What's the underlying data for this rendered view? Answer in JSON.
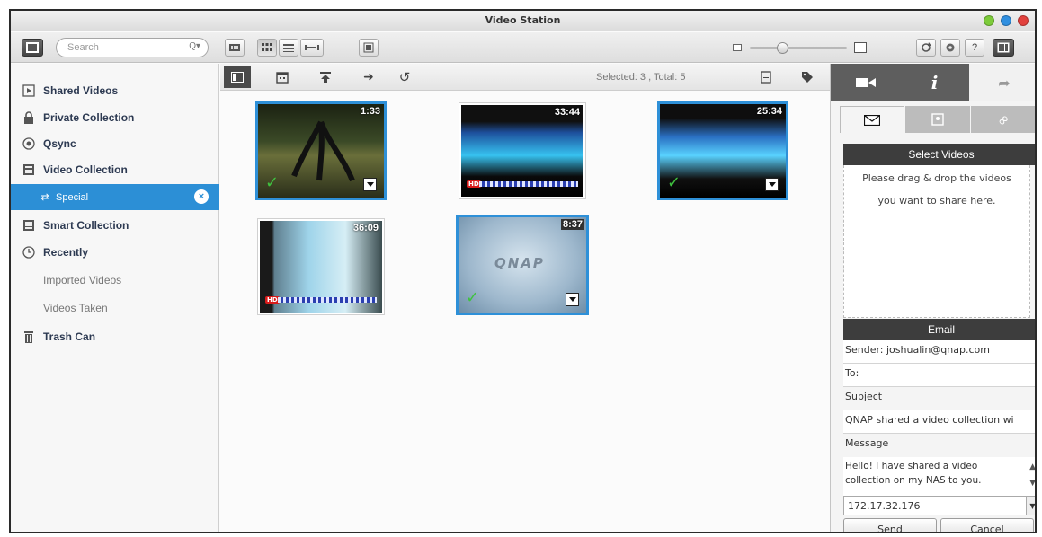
{
  "window": {
    "title": "Video Station"
  },
  "toolbar": {
    "search_placeholder": "Search"
  },
  "sidebar": {
    "items": [
      {
        "label": "Shared Videos",
        "icon": "shared-videos-icon"
      },
      {
        "label": "Private Collection",
        "icon": "lock-icon"
      },
      {
        "label": "Qsync",
        "icon": "qsync-icon"
      },
      {
        "label": "Video Collection",
        "icon": "video-collection-icon"
      },
      {
        "label": "Special",
        "icon": "share-link-icon"
      },
      {
        "label": "Smart Collection",
        "icon": "smart-collection-icon"
      },
      {
        "label": "Recently",
        "icon": "clock-icon"
      },
      {
        "label": "Imported Videos"
      },
      {
        "label": "Videos Taken"
      },
      {
        "label": "Trash Can",
        "icon": "trash-icon"
      }
    ]
  },
  "content": {
    "selection": "Selected: 3 , Total: 5",
    "videos": [
      {
        "duration": "1:33",
        "selected": true
      },
      {
        "duration": "33:44",
        "selected": false
      },
      {
        "duration": "25:34",
        "selected": true
      },
      {
        "duration": "36:09",
        "selected": false
      },
      {
        "duration": "8:37",
        "selected": true,
        "logo": "QNAP"
      }
    ]
  },
  "share": {
    "select_title": "Select Videos",
    "drop_hint_line1": "Please drag & drop the videos",
    "drop_hint_line2": "you want to share here.",
    "email_title": "Email",
    "sender": "Sender: joshualin@qnap.com",
    "to_label": "To:",
    "subject_label": "Subject",
    "subject_value": "QNAP shared a video collection wi",
    "message_label": "Message",
    "message_value": "Hello! I have shared a video collection on my NAS to you.",
    "ip": "172.17.32.176",
    "send_label": "Send",
    "cancel_label": "Cancel"
  },
  "colors": {
    "accent": "#2c8fd6",
    "selection_border": "#2e90d8",
    "header_dark": "#3d3d3d",
    "check": "#3fc23f"
  }
}
